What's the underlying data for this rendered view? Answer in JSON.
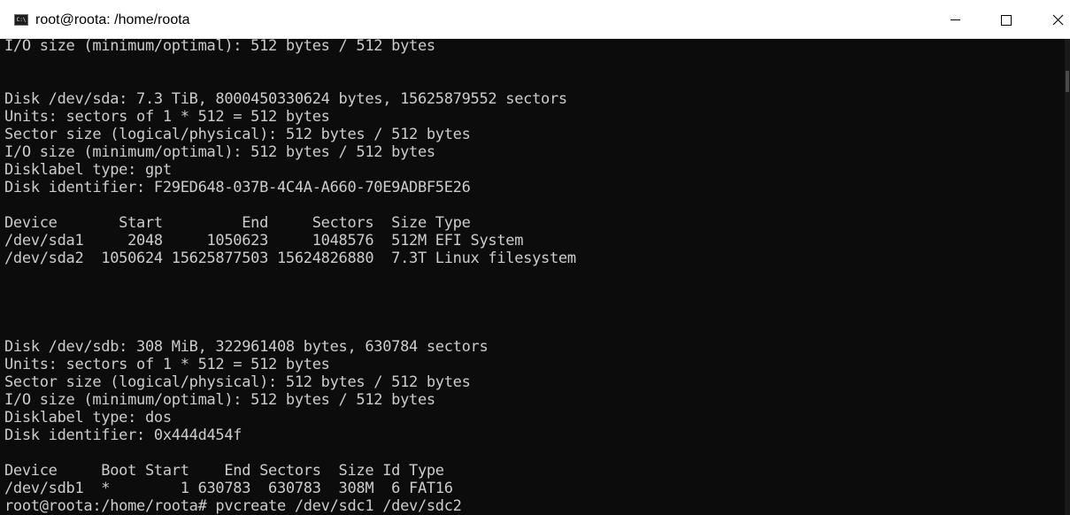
{
  "window": {
    "title": "root@roota: /home/roota",
    "icon": "command-prompt-icon",
    "icon_text": "C:\\"
  },
  "terminal": {
    "lines": [
      "I/O size (minimum/optimal): 512 bytes / 512 bytes",
      "",
      "",
      "Disk /dev/sda: 7.3 TiB, 8000450330624 bytes, 15625879552 sectors",
      "Units: sectors of 1 * 512 = 512 bytes",
      "Sector size (logical/physical): 512 bytes / 512 bytes",
      "I/O size (minimum/optimal): 512 bytes / 512 bytes",
      "Disklabel type: gpt",
      "Disk identifier: F29ED648-037B-4C4A-A660-70E9ADBF5E26",
      "",
      "Device       Start         End     Sectors  Size Type",
      "/dev/sda1     2048     1050623     1048576  512M EFI System",
      "/dev/sda2  1050624 15625877503 15624826880  7.3T Linux filesystem",
      "",
      "",
      "",
      "",
      "Disk /dev/sdb: 308 MiB, 322961408 bytes, 630784 sectors",
      "Units: sectors of 1 * 512 = 512 bytes",
      "Sector size (logical/physical): 512 bytes / 512 bytes",
      "I/O size (minimum/optimal): 512 bytes / 512 bytes",
      "Disklabel type: dos",
      "Disk identifier: 0x444d454f",
      "",
      "Device     Boot Start    End Sectors  Size Id Type",
      "/dev/sdb1  *        1 630783  630783  308M  6 FAT16",
      "root@roota:/home/roota# pvcreate /dev/sdc1 /dev/sdc2"
    ]
  },
  "colors": {
    "terminal_background": "#0c0c0c",
    "terminal_text": "#cccccc",
    "titlebar_background": "#ffffff"
  }
}
